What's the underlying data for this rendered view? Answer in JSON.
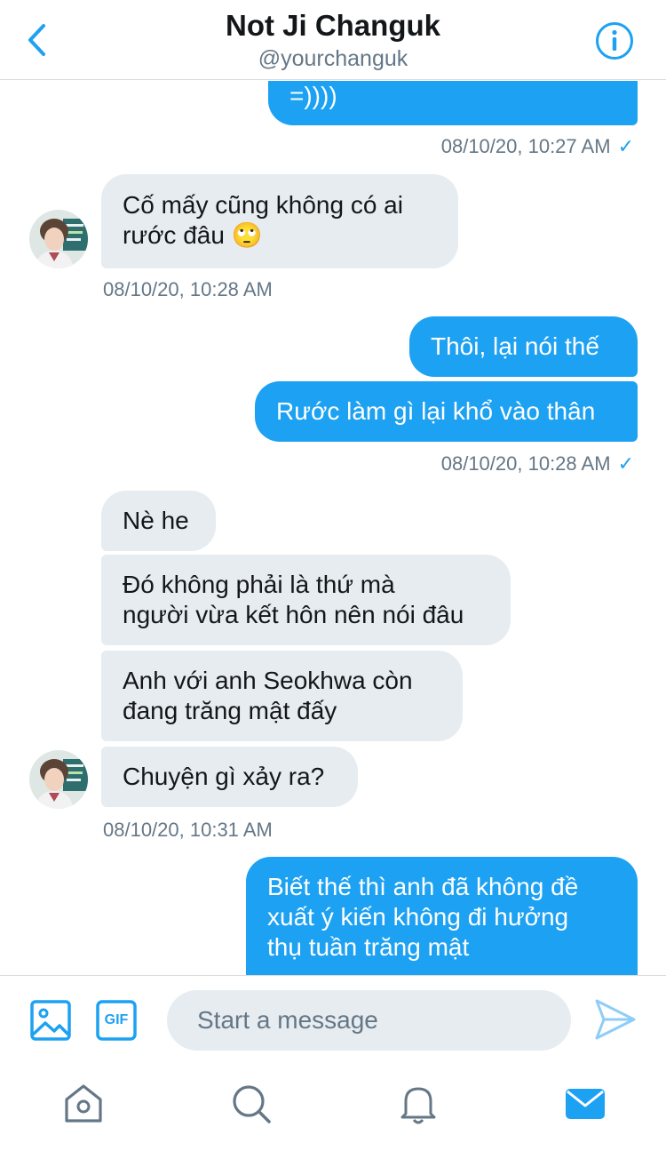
{
  "header": {
    "title": "Not Ji Changuk",
    "handle": "@yourchanguk"
  },
  "messages": [
    {
      "side": "out",
      "text": "=))))"
    },
    {
      "side": "out_ts",
      "text": "08/10/20, 10:27 AM"
    },
    {
      "side": "in",
      "text": "Cố mấy cũng không có ai rước đâu 🙄"
    },
    {
      "side": "in_ts",
      "text": "08/10/20, 10:28 AM"
    },
    {
      "side": "out",
      "text": "Thôi, lại nói thế"
    },
    {
      "side": "out",
      "text": "Rước làm gì lại khổ vào thân"
    },
    {
      "side": "out_ts",
      "text": "08/10/20, 10:28 AM"
    },
    {
      "side": "in",
      "text": "Nè he"
    },
    {
      "side": "in",
      "text": "Đó không phải là thứ mà người vừa kết hôn nên nói đâu"
    },
    {
      "side": "in",
      "text": "Anh với anh Seokhwa còn đang trăng mật đấy"
    },
    {
      "side": "in",
      "text": "Chuyện gì xảy ra?"
    },
    {
      "side": "in_ts",
      "text": "08/10/20, 10:31 AM"
    },
    {
      "side": "out",
      "text": "Biết thế thì anh đã không đề xuất ý kiến không đi hưởng thụ tuần trăng mật"
    }
  ],
  "chat": {
    "m0": "=))))",
    "ts0": "08/10/20, 10:27 AM",
    "m1_line1": "Cố mấy cũng không có ai",
    "m1_line2": "rước đâu 🙄",
    "ts1": "08/10/20, 10:28 AM",
    "m2": "Thôi, lại nói thế",
    "m3": "Rước làm gì lại khổ vào thân",
    "ts2": "08/10/20, 10:28 AM",
    "m4": "Nè he",
    "m5_line1": "Đó không phải là thứ mà",
    "m5_line2": "người vừa kết hôn nên nói đâu",
    "m6_line1": "Anh với anh Seokhwa còn",
    "m6_line2": "đang trăng mật đấy",
    "m7": "Chuyện gì xảy ra?",
    "ts3": "08/10/20, 10:31 AM",
    "m8_line1": "Biết thế thì anh đã không đề",
    "m8_line2": "xuất ý kiến không đi hưởng",
    "m8_line3": "thụ tuần trăng mật",
    "check": "✓"
  },
  "composer": {
    "placeholder": "Start a message",
    "gif_label": "GIF"
  },
  "icons": {
    "back": "chevron-left-icon",
    "info": "info-icon",
    "image": "image-icon",
    "gif": "gif-icon",
    "send": "send-icon",
    "home": "home-icon",
    "search": "search-icon",
    "notifications": "bell-icon",
    "messages": "mail-icon"
  },
  "colors": {
    "accent": "#1da1f2",
    "incoming_bubble": "#e6ecf0",
    "muted_text": "#657786",
    "nav_icon": "#657786"
  }
}
